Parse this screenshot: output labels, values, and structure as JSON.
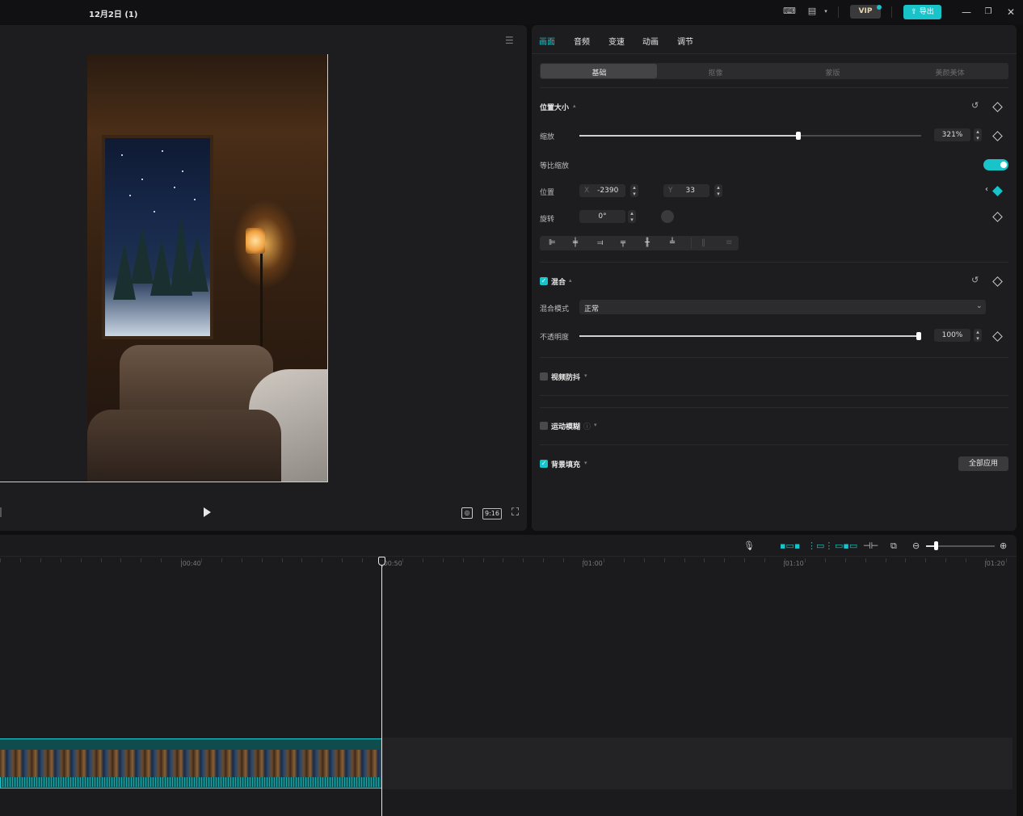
{
  "title_bar": {
    "project_title": "12月2日 (1)",
    "vip_label": "VIP",
    "export_label": "导出",
    "icons": [
      "keyboard-icon",
      "layout-icon",
      "chevron-down-icon",
      "minimize-icon",
      "restore-icon",
      "close-icon"
    ]
  },
  "player": {
    "aspect_ratio": "9:16",
    "icons": [
      "menu-icon",
      "play-icon",
      "fit-screen-icon",
      "fullscreen-icon"
    ]
  },
  "properties": {
    "tabs": [
      "画面",
      "音频",
      "变速",
      "动画",
      "调节"
    ],
    "active_tab": "画面",
    "subtabs": [
      "基础",
      "抠像",
      "蒙版",
      "美颜美体"
    ],
    "active_subtab": "基础",
    "position_size": {
      "title": "位置大小",
      "scale_label": "缩放",
      "scale_value": "321%",
      "scale_fraction": 0.64,
      "uniform_scale_label": "等比缩放",
      "uniform_scale_on": true,
      "position_label": "位置",
      "x_label": "X",
      "x_value": "-2390",
      "y_label": "Y",
      "y_value": "33",
      "rotation_label": "旋转",
      "rotation_value": "0°"
    },
    "blend": {
      "title": "混合",
      "checked": true,
      "mode_label": "混合模式",
      "mode_value": "正常",
      "opacity_label": "不透明度",
      "opacity_value": "100%",
      "opacity_fraction": 1.0
    },
    "stabilize": {
      "title": "视频防抖",
      "checked": false
    },
    "motion_blur": {
      "title": "运动模糊",
      "checked": false
    },
    "background_fill": {
      "title": "背景填充",
      "checked": true,
      "apply_all_label": "全部应用"
    }
  },
  "timeline": {
    "tick_labels": [
      "|00:40",
      "|00:50",
      "|01:00",
      "|01:10",
      "|01:20"
    ],
    "playhead_time": "00:50",
    "colors": {
      "accent": "#18c3c9"
    }
  }
}
